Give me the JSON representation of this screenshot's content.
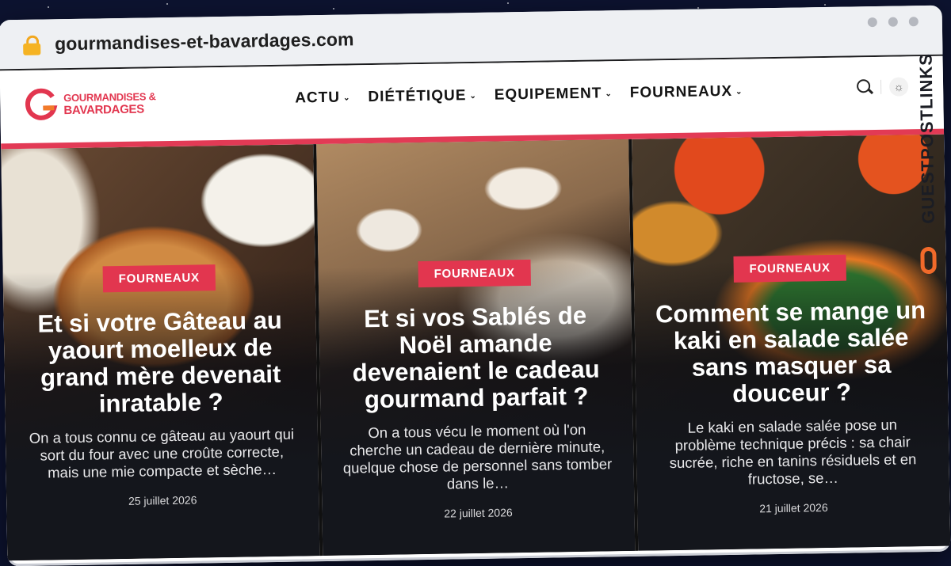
{
  "browser": {
    "url": "gourmandises-et-bavardages.com",
    "lock_icon": "lock-icon"
  },
  "site": {
    "logo_line1": "GOURMANDISES &",
    "logo_line2": "BAVARDAGES",
    "brand_color": "#e2364f",
    "nav": [
      {
        "label": "ACTU"
      },
      {
        "label": "DIÉTÉTIQUE"
      },
      {
        "label": "EQUIPEMENT"
      },
      {
        "label": "FOURNEAUX"
      }
    ],
    "icons": [
      "search-icon",
      "theme-toggle-icon"
    ]
  },
  "cards": [
    {
      "category": "FOURNEAUX",
      "title": "Et si votre Gâteau au yaourt moelleux de grand mère devenait inratable ?",
      "excerpt": "On a tous connu ce gâteau au yaourt qui sort du four avec une croûte correcte, mais une mie compacte et sèche…",
      "date": "25 juillet 2026"
    },
    {
      "category": "FOURNEAUX",
      "title": "Et si vos Sablés de Noël amande devenaient le cadeau gourmand parfait ?",
      "excerpt": "On a tous vécu le moment où l'on cherche un cadeau de dernière minute, quelque chose de personnel sans tomber dans le…",
      "date": "22 juillet 2026"
    },
    {
      "category": "FOURNEAUX",
      "title": "Comment se mange un kaki en salade salée sans masquer sa douceur ?",
      "excerpt": "Le kaki en salade salée pose un problème technique précis : sa chair sucrée, riche en tanins résiduels et en fructose, se…",
      "date": "21 juillet 2026"
    }
  ],
  "watermark": {
    "text": "GUESTPOSTLINKS"
  }
}
